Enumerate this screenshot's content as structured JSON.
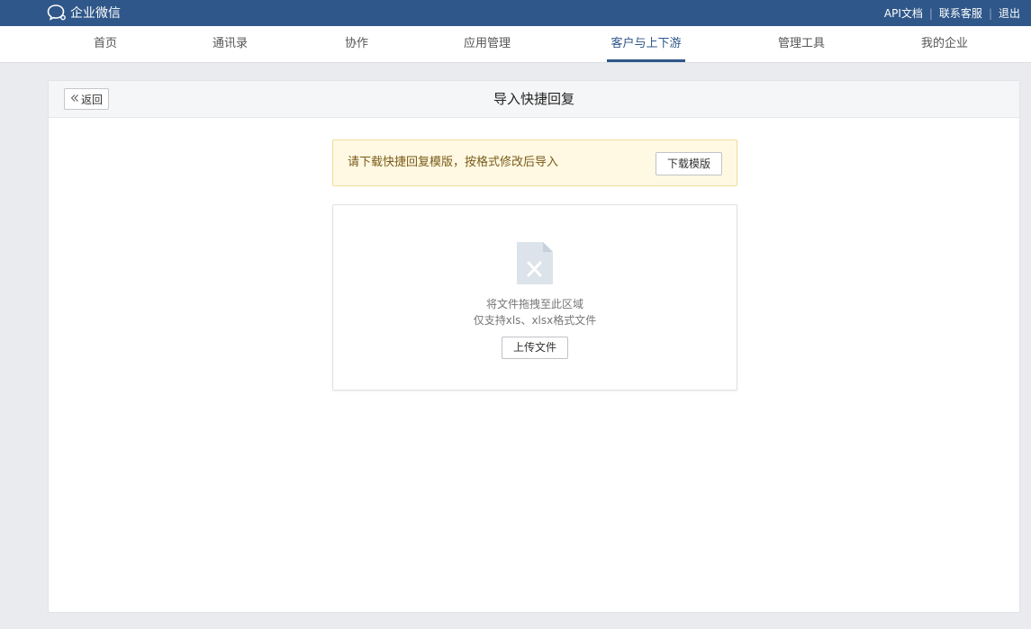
{
  "brand": {
    "name": "企业微信",
    "icon": "chat-bubble-icon"
  },
  "toplinks": [
    {
      "label": "API文档"
    },
    {
      "label": "联系客服"
    },
    {
      "label": "退出"
    }
  ],
  "toplink_separator": "|",
  "nav": {
    "items": [
      {
        "label": "首页"
      },
      {
        "label": "通讯录"
      },
      {
        "label": "协作"
      },
      {
        "label": "应用管理"
      },
      {
        "label": "客户与上下游",
        "active": true
      },
      {
        "label": "管理工具"
      },
      {
        "label": "我的企业"
      }
    ]
  },
  "panel": {
    "back_label": "返回",
    "back_icon": "double-chevron-left-icon",
    "title": "导入快捷回复"
  },
  "notice": {
    "text": "请下载快捷回复模版，按格式修改后导入",
    "download_label": "下载模版"
  },
  "dropzone": {
    "icon": "excel-file-icon",
    "line1": "将文件拖拽至此区域",
    "line2": "仅支持xls、xlsx格式文件",
    "upload_label": "上传文件"
  },
  "colors": {
    "topbar": "#2f5789",
    "accent": "#2f5789",
    "notice_bg": "#fff9e3",
    "notice_text": "#7a5a18"
  }
}
